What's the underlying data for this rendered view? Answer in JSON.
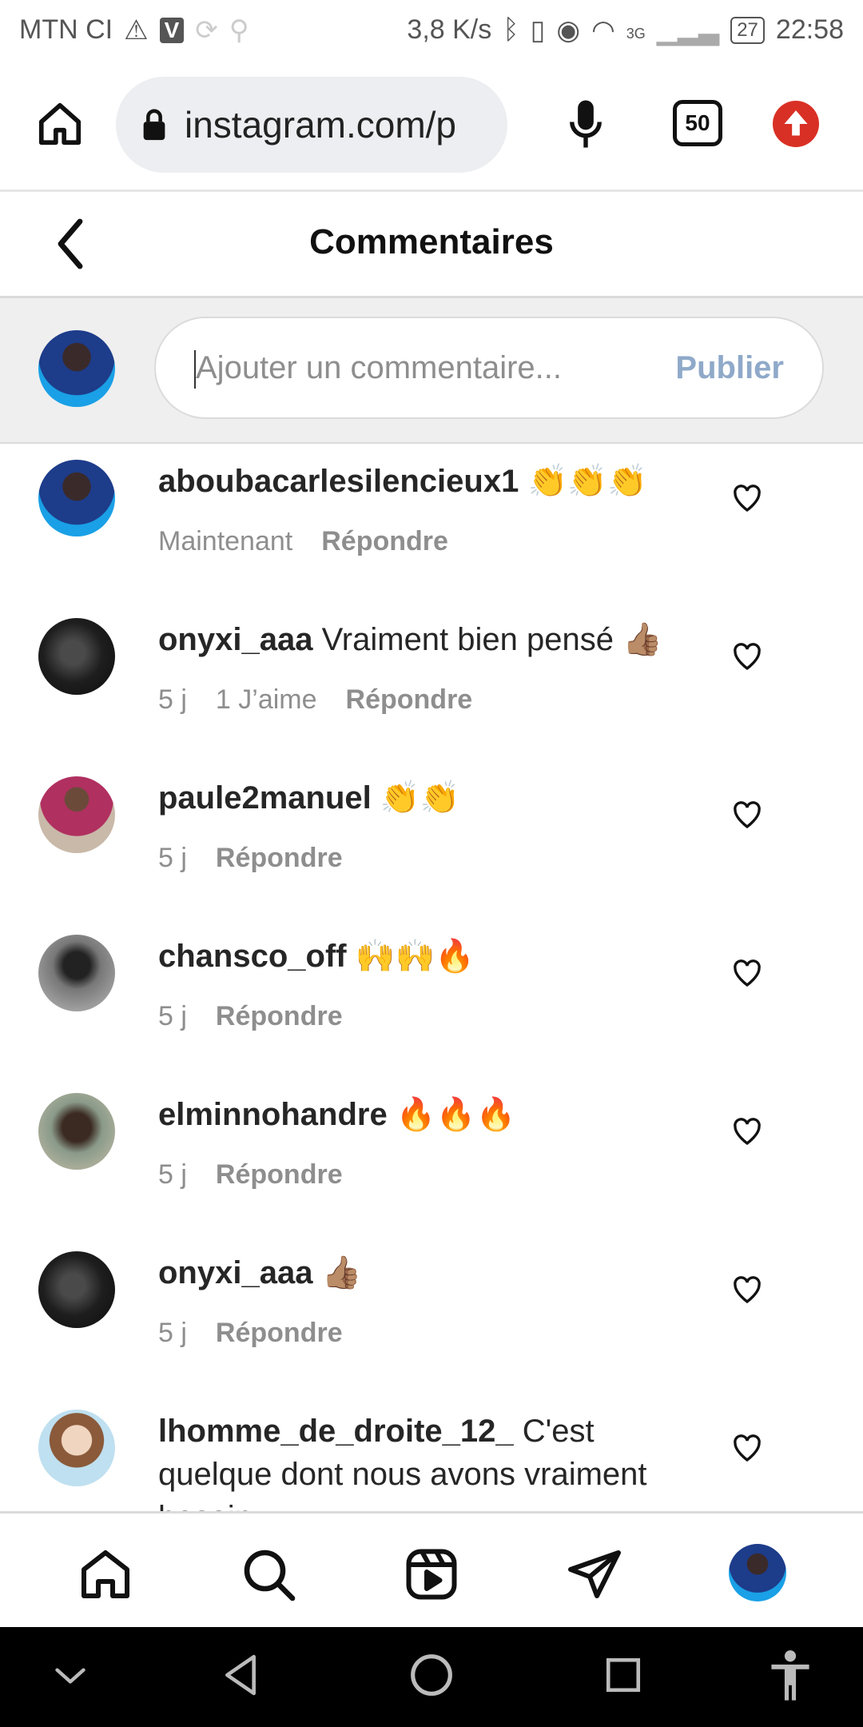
{
  "status_bar": {
    "carrier": "MTN CI",
    "speed": "3,8 K/s",
    "network": "3G",
    "battery": "27",
    "time": "22:58"
  },
  "browser": {
    "url": "instagram.com/p",
    "tab_count": "50"
  },
  "header": {
    "title": "Commentaires"
  },
  "composer": {
    "placeholder": "Ajouter un commentaire...",
    "publish_label": "Publier"
  },
  "comments": [
    {
      "username": "aboubacarlesilencieux1",
      "text": "👏👏👏",
      "time": "Maintenant",
      "likes": "",
      "reply_label": "Répondre"
    },
    {
      "username": "onyxi_aaa",
      "text": "Vraiment bien pensé 👍🏽",
      "time": "5 j",
      "likes": "1 J’aime",
      "reply_label": "Répondre"
    },
    {
      "username": "paule2manuel",
      "text": "👏👏",
      "time": "5 j",
      "likes": "",
      "reply_label": "Répondre"
    },
    {
      "username": "chansco_off",
      "text": "🙌🙌🔥",
      "time": "5 j",
      "likes": "",
      "reply_label": "Répondre"
    },
    {
      "username": "elminnohandre",
      "text": "🔥🔥🔥",
      "time": "5 j",
      "likes": "",
      "reply_label": "Répondre"
    },
    {
      "username": "onyxi_aaa",
      "text": "👍🏽",
      "time": "5 j",
      "likes": "",
      "reply_label": "Répondre"
    },
    {
      "username": "lhomme_de_droite_12_",
      "text": "C'est quelque dont nous avons vraiment besoin",
      "time": "",
      "likes": "",
      "reply_label": ""
    }
  ]
}
